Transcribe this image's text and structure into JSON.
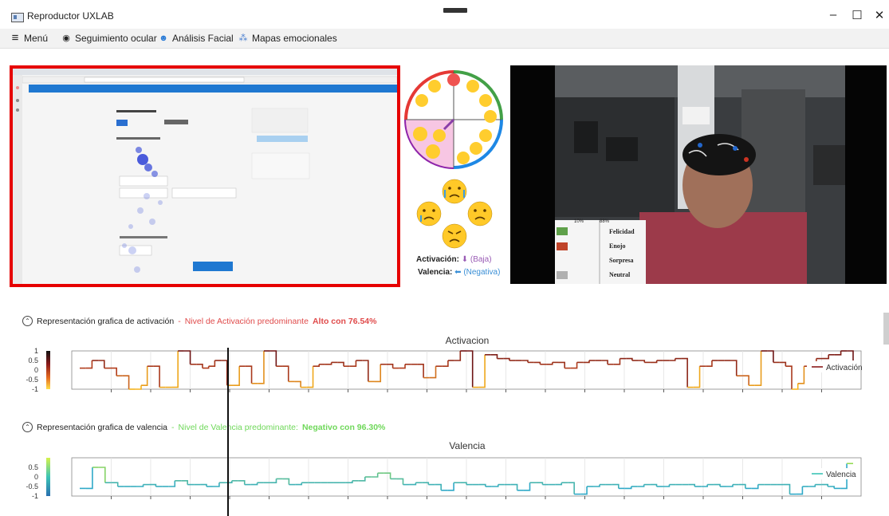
{
  "window": {
    "title": "Reproductor UXLAB",
    "minimize": "–",
    "maximize": "☐",
    "close": "✕"
  },
  "menu": [
    {
      "label": "Menú",
      "icon": "hamburger-icon",
      "glyph": "≡"
    },
    {
      "label": "Seguimiento ocular",
      "icon": "eye-icon",
      "glyph": "◉"
    },
    {
      "label": "Análisis Facial",
      "icon": "face-icon",
      "glyph": "☻"
    },
    {
      "label": "Mapas emocionales",
      "icon": "heatmap-icon",
      "glyph": "⁂"
    }
  ],
  "emotion_panel": {
    "activation_label": "Activación:",
    "activation_value": "(Baja)",
    "valence_label": "Valencia:",
    "valence_value": "(Negativa)"
  },
  "webcam_overlay": {
    "headers": [
      "10%",
      "88%"
    ],
    "emotions": [
      "Felicidad",
      "Enojo",
      "Sorpresa",
      "Neutral"
    ],
    "colors": [
      "#5fa04a",
      "#c0442a",
      "#ffffff",
      "#b0b0b0"
    ]
  },
  "activation": {
    "header_prefix": "Representación grafica de activación",
    "header_dash": " - ",
    "header_level": "Nivel de Activación predominante",
    "header_value": "Alto con 76.54%",
    "chart_title": "Activacion"
  },
  "valence": {
    "header_prefix": "Representación grafica de valencia",
    "header_dash": " - ",
    "header_level": "Nivel de Valencia predominante:",
    "header_value": "Negativo con 96.30%",
    "chart_title": "Valencia"
  },
  "chart_data": [
    {
      "type": "line",
      "title": "Activacion",
      "legend": "Activación",
      "legend_position": "right",
      "ylim": [
        -1,
        1
      ],
      "yticks": [
        "1",
        "0.5",
        "0",
        "-0.5",
        "-1"
      ],
      "values": [
        0.1,
        0.1,
        0.5,
        0.5,
        0.1,
        0.1,
        -0.3,
        -0.3,
        -1,
        -1,
        -0.8,
        0.2,
        0.2,
        -0.9,
        -0.9,
        -0.9,
        1,
        1,
        0.3,
        0.3,
        0.1,
        0.2,
        0.5,
        0.5,
        -0.8,
        -0.8,
        0.2,
        0.2,
        -0.7,
        -0.7,
        1,
        1,
        0.2,
        0.2,
        -0.6,
        -0.6,
        -0.9,
        -0.9,
        0.2,
        0.3,
        0.3,
        0.4,
        0.4,
        0.2,
        0.2,
        0.5,
        0.5,
        -0.6,
        -0.6,
        0.3,
        0.3,
        0.1,
        0.1,
        0.3,
        0.3,
        0.3,
        -0.4,
        -0.4,
        0.2,
        0.2,
        0.5,
        0.5,
        1,
        1,
        -0.9,
        -0.9,
        0.8,
        0.8,
        0.6,
        0.6,
        0.5,
        0.5,
        0.5,
        0.4,
        0.4,
        0.3,
        0.3,
        0.4,
        0.4,
        0.1,
        0.1,
        0.4,
        0.4,
        0.5,
        0.5,
        0.5,
        0.3,
        0.3,
        0.6,
        0.6,
        0.5,
        0.5,
        0.4,
        0.4,
        0.5,
        0.5,
        0.5,
        0.6,
        0.6,
        -0.9,
        -0.9,
        0.2,
        0.2,
        0.5,
        0.5,
        0.5,
        0.5,
        -0.3,
        -0.3,
        -0.8,
        -0.8,
        1,
        1,
        0.4,
        0.4,
        0.2,
        -1,
        -0.7,
        0.2,
        0.2,
        0.6,
        0.6,
        0.8,
        0.8,
        1,
        1,
        0.5
      ],
      "marker_x": 26
    },
    {
      "type": "line",
      "title": "Valencia",
      "legend": "Valencia",
      "legend_position": "right",
      "ylim": [
        -1,
        1
      ],
      "yticks": [
        "0.5",
        "0",
        "-0.5",
        "-1"
      ],
      "values": [
        -0.6,
        -0.6,
        0.5,
        0.5,
        -0.3,
        -0.3,
        -0.5,
        -0.5,
        -0.5,
        -0.5,
        -0.4,
        -0.4,
        -0.5,
        -0.5,
        -0.5,
        -0.2,
        -0.2,
        -0.4,
        -0.4,
        -0.4,
        -0.5,
        -0.5,
        -0.3,
        -0.3,
        -0.2,
        -0.2,
        -0.4,
        -0.4,
        -0.3,
        -0.3,
        -0.3,
        -0.1,
        -0.1,
        -0.4,
        -0.4,
        -0.3,
        -0.3,
        -0.3,
        -0.3,
        -0.3,
        -0.3,
        -0.3,
        -0.3,
        -0.2,
        -0.2,
        0,
        0,
        0.2,
        0.2,
        -0.1,
        -0.1,
        -0.4,
        -0.4,
        -0.3,
        -0.3,
        -0.4,
        -0.4,
        -0.7,
        -0.7,
        -0.3,
        -0.3,
        -0.4,
        -0.4,
        -0.4,
        -0.5,
        -0.5,
        -0.4,
        -0.4,
        -0.4,
        -0.7,
        -0.7,
        -0.3,
        -0.3,
        -0.4,
        -0.4,
        -0.4,
        -0.3,
        -0.3,
        -0.9,
        -0.9,
        -0.5,
        -0.5,
        -0.4,
        -0.4,
        -0.4,
        -0.6,
        -0.6,
        -0.5,
        -0.5,
        -0.4,
        -0.4,
        -0.5,
        -0.5,
        -0.4,
        -0.4,
        -0.4,
        -0.4,
        -0.5,
        -0.5,
        -0.4,
        -0.4,
        -0.5,
        -0.5,
        -0.4,
        -0.4,
        -0.6,
        -0.6,
        -0.4,
        -0.4,
        -0.4,
        -0.4,
        -0.4,
        -0.9,
        -0.9,
        -0.5,
        -0.5,
        -0.4,
        -0.4,
        -0.5,
        -0.6,
        -0.6,
        0.7,
        0.7
      ],
      "marker_x": 26
    }
  ],
  "colors": {
    "highlight": "#e60000",
    "activation_hi": "#8b1a1a",
    "activation_lo": "#f2a11b",
    "valence": "#3cc4b5",
    "accent": "#3a8fd6"
  }
}
